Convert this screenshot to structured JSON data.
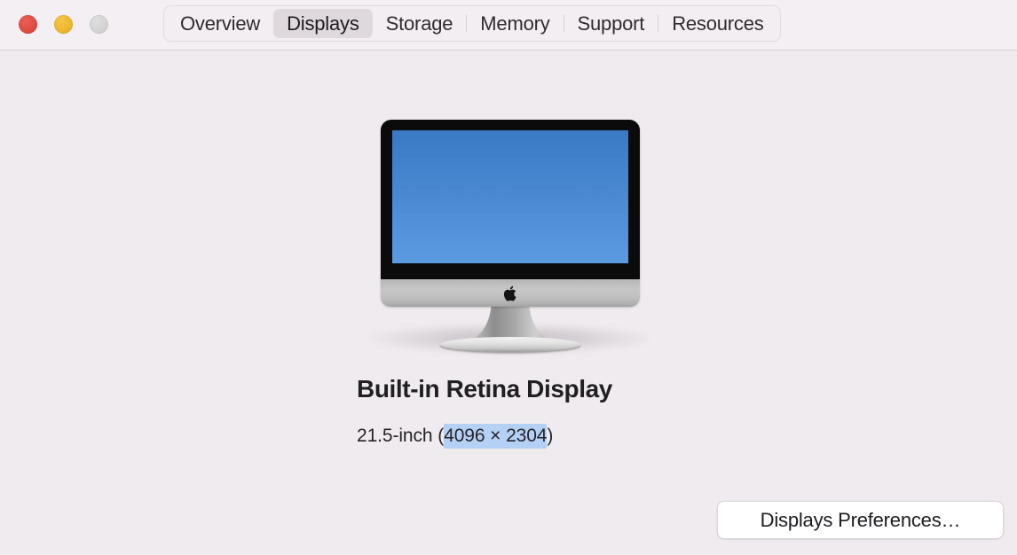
{
  "window": {
    "background_color": "#f0ebef",
    "traffic_lights": [
      {
        "name": "close",
        "color": "#e0483e",
        "enabled": true
      },
      {
        "name": "minimize",
        "color": "#eeb52b",
        "enabled": true
      },
      {
        "name": "zoom",
        "color": "#d2d2d2",
        "enabled": false
      }
    ]
  },
  "toolbar": {
    "background_color": "#f4eff3",
    "tabs": [
      {
        "label": "Overview",
        "selected": false
      },
      {
        "label": "Displays",
        "selected": true
      },
      {
        "label": "Storage",
        "selected": false
      },
      {
        "label": "Memory",
        "selected": false
      },
      {
        "label": "Support",
        "selected": false
      },
      {
        "label": "Resources",
        "selected": false
      }
    ],
    "selected_tab_background": "#dfd9de"
  },
  "main": {
    "device_illustration": "imac-display-illustration",
    "apple_logo": "apple-logo-icon",
    "screen_gradient_top": "#3a79c4",
    "screen_gradient_bottom": "#5c9ae2",
    "display_title": "Built-in Retina Display",
    "subtitle_prefix": "21.5-inch (",
    "subtitle_resolution": "4096 × 2304",
    "subtitle_suffix": ")",
    "selection_highlight_color": "#b4d0f5"
  },
  "footer": {
    "preferences_button_label": "Displays Preferences…"
  }
}
